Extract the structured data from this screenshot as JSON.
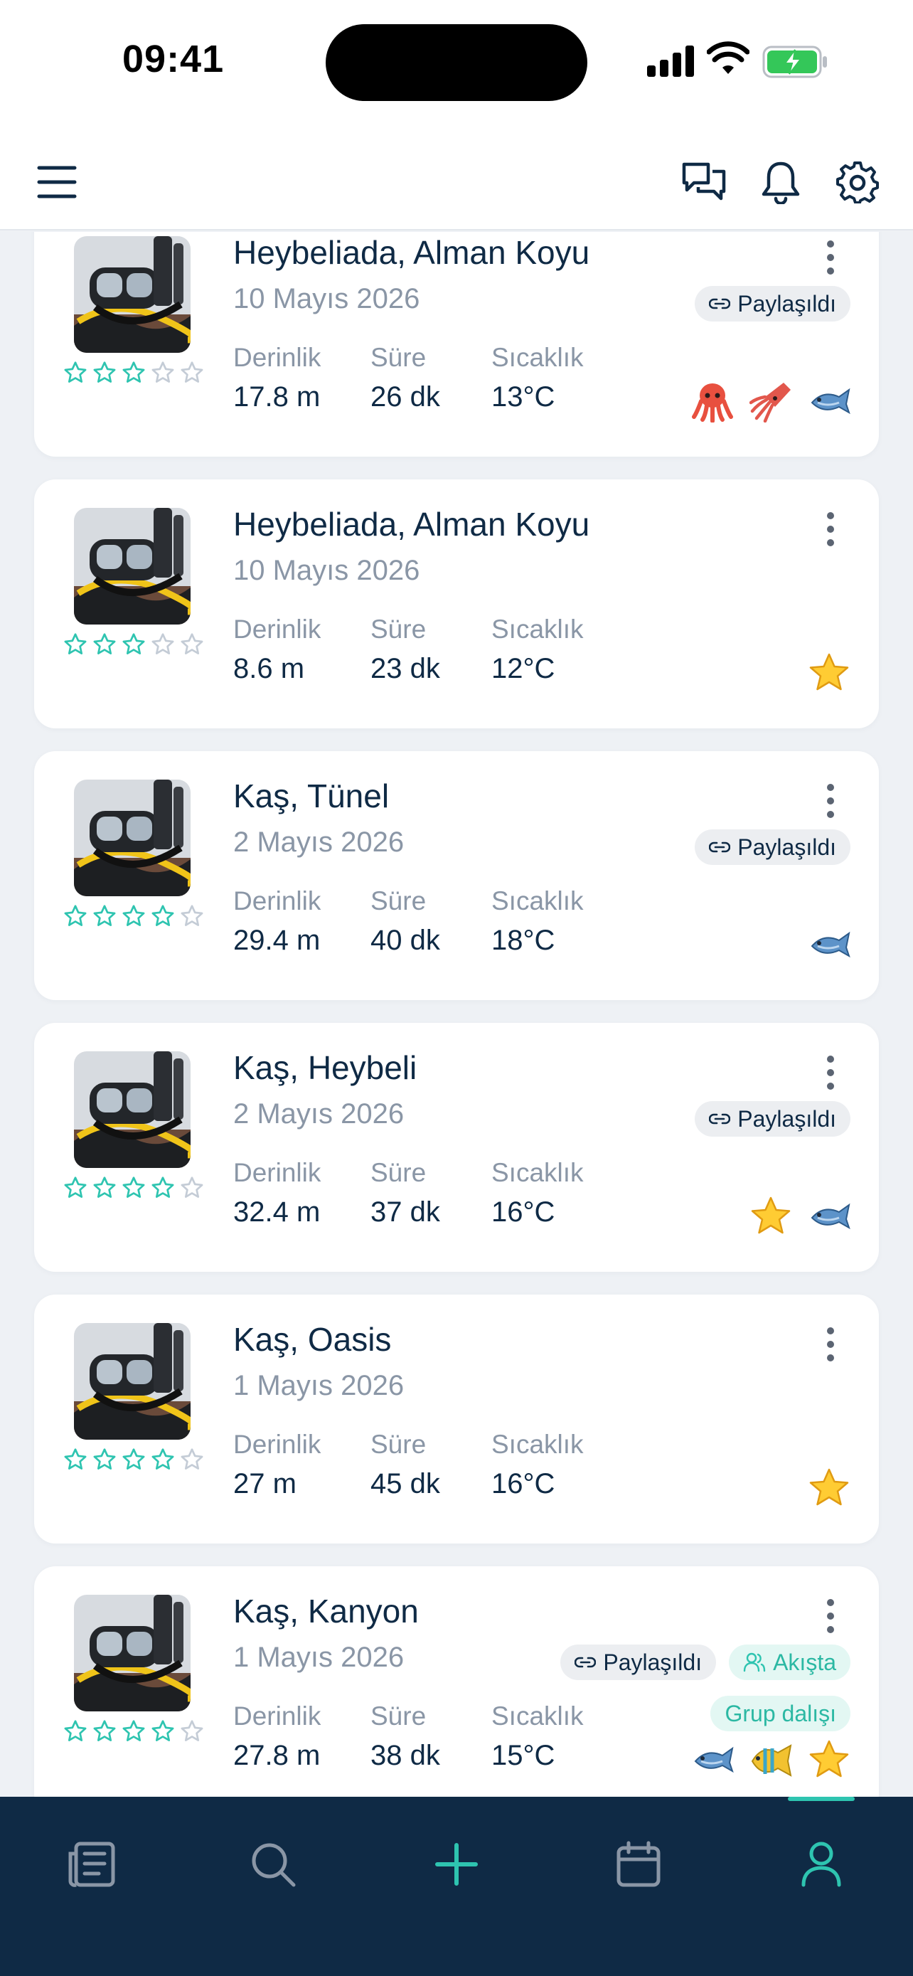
{
  "status": {
    "time": "09:41"
  },
  "header": {
    "menu_icon": "hamburger-icon",
    "chat_icon": "chat-icon",
    "bell_icon": "bell-icon",
    "settings_icon": "gear-icon"
  },
  "colors": {
    "accent": "#2ec4b0",
    "navy": "#0f2a45",
    "muted": "#8a96a6"
  },
  "labels": {
    "depth": "Derinlik",
    "duration": "Süre",
    "temp": "Sıcaklık",
    "shared": "Paylaşıldı",
    "feed": "Akışta",
    "group": "Grup dalışı"
  },
  "dives": [
    {
      "title": "Heybeliada, Alman Koyu",
      "date": "10 Mayıs 2026",
      "rating": 3,
      "depth": "17.8 m",
      "duration": "26 dk",
      "temp": "13°C",
      "shared": true,
      "feed": false,
      "group": false,
      "species": [
        "octopus",
        "squid",
        "fish"
      ]
    },
    {
      "title": "Heybeliada, Alman Koyu",
      "date": "10 Mayıs 2026",
      "rating": 3,
      "depth": "8.6 m",
      "duration": "23 dk",
      "temp": "12°C",
      "shared": false,
      "feed": false,
      "group": false,
      "species": [
        "star"
      ]
    },
    {
      "title": "Kaş, Tünel",
      "date": "2 Mayıs 2026",
      "rating": 4,
      "depth": "29.4 m",
      "duration": "40 dk",
      "temp": "18°C",
      "shared": true,
      "feed": false,
      "group": false,
      "species": [
        "fish"
      ]
    },
    {
      "title": "Kaş, Heybeli",
      "date": "2 Mayıs 2026",
      "rating": 4,
      "depth": "32.4 m",
      "duration": "37 dk",
      "temp": "16°C",
      "shared": true,
      "feed": false,
      "group": false,
      "species": [
        "star",
        "fish"
      ]
    },
    {
      "title": "Kaş, Oasis",
      "date": "1 Mayıs 2026",
      "rating": 4,
      "depth": "27 m",
      "duration": "45 dk",
      "temp": "16°C",
      "shared": false,
      "feed": false,
      "group": false,
      "species": [
        "star"
      ]
    },
    {
      "title": "Kaş, Kanyon",
      "date": "1 Mayıs 2026",
      "rating": 4,
      "depth": "27.8 m",
      "duration": "38 dk",
      "temp": "15°C",
      "shared": true,
      "feed": true,
      "group": true,
      "species": [
        "fish",
        "tropical-fish",
        "star"
      ]
    }
  ],
  "nav": [
    {
      "icon": "logbook-icon",
      "active": false
    },
    {
      "icon": "search-icon",
      "active": false
    },
    {
      "icon": "plus-icon",
      "active": false
    },
    {
      "icon": "calendar-icon",
      "active": false
    },
    {
      "icon": "profile-icon",
      "active": true
    }
  ]
}
